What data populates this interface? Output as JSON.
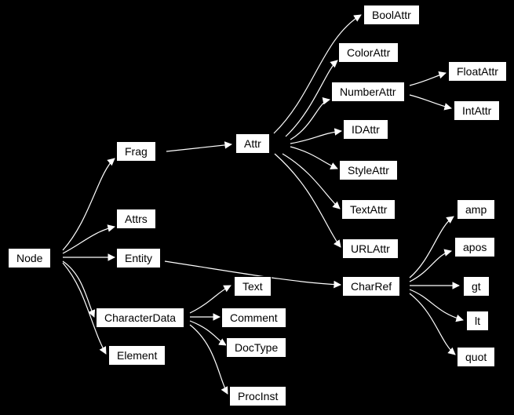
{
  "nodes": {
    "node": {
      "label": "Node"
    },
    "frag": {
      "label": "Frag"
    },
    "attrs": {
      "label": "Attrs"
    },
    "entity": {
      "label": "Entity"
    },
    "characterData": {
      "label": "CharacterData"
    },
    "element": {
      "label": "Element"
    },
    "attr": {
      "label": "Attr"
    },
    "text": {
      "label": "Text"
    },
    "comment": {
      "label": "Comment"
    },
    "docType": {
      "label": "DocType"
    },
    "procInst": {
      "label": "ProcInst"
    },
    "boolAttr": {
      "label": "BoolAttr"
    },
    "colorAttr": {
      "label": "ColorAttr"
    },
    "numberAttr": {
      "label": "NumberAttr"
    },
    "idAttr": {
      "label": "IDAttr"
    },
    "styleAttr": {
      "label": "StyleAttr"
    },
    "textAttr": {
      "label": "TextAttr"
    },
    "urlAttr": {
      "label": "URLAttr"
    },
    "charRef": {
      "label": "CharRef"
    },
    "floatAttr": {
      "label": "FloatAttr"
    },
    "intAttr": {
      "label": "IntAttr"
    },
    "amp": {
      "label": "amp"
    },
    "apos": {
      "label": "apos"
    },
    "gt": {
      "label": "gt"
    },
    "lt": {
      "label": "lt"
    },
    "quot": {
      "label": "quot"
    }
  }
}
